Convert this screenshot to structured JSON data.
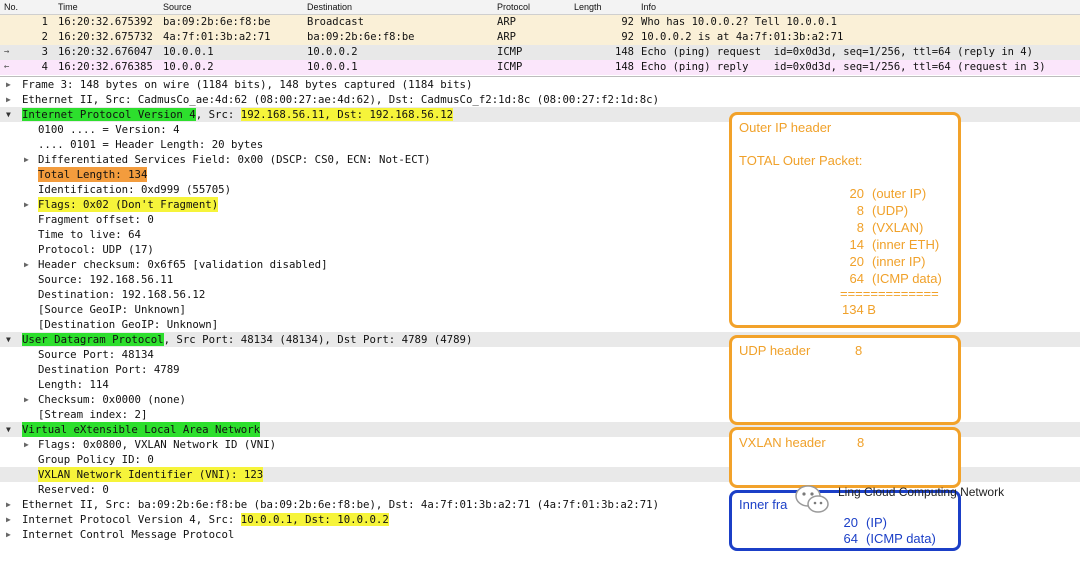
{
  "packet_list": {
    "headers": {
      "no": "No.",
      "time": "Time",
      "source": "Source",
      "destination": "Destination",
      "protocol": "Protocol",
      "length": "Length",
      "info": "Info"
    },
    "rows": [
      {
        "no": "1",
        "time": "16:20:32.675392",
        "source": "ba:09:2b:6e:f8:be",
        "destination": "Broadcast",
        "protocol": "ARP",
        "length": "92",
        "info": "Who has 10.0.0.2? Tell 10.0.0.1"
      },
      {
        "no": "2",
        "time": "16:20:32.675732",
        "source": "4a:7f:01:3b:a2:71",
        "destination": "ba:09:2b:6e:f8:be",
        "protocol": "ARP",
        "length": "92",
        "info": "10.0.0.2 is at 4a:7f:01:3b:a2:71"
      },
      {
        "no": "3",
        "time": "16:20:32.676047",
        "source": "10.0.0.1",
        "destination": "10.0.0.2",
        "protocol": "ICMP",
        "length": "148",
        "info": "Echo (ping) request  id=0x0d3d, seq=1/256, ttl=64 (reply in 4)"
      },
      {
        "no": "4",
        "time": "16:20:32.676385",
        "source": "10.0.0.2",
        "destination": "10.0.0.1",
        "protocol": "ICMP",
        "length": "148",
        "info": "Echo (ping) reply    id=0x0d3d, seq=1/256, ttl=64 (request in 3)"
      }
    ]
  },
  "details": {
    "frame": "Frame 3: 148 bytes on wire (1184 bits), 148 bytes captured (1184 bits)",
    "ethernet": "Ethernet II, Src: CadmusCo_ae:4d:62 (08:00:27:ae:4d:62), Dst: CadmusCo_f2:1d:8c (08:00:27:f2:1d:8c)",
    "ip_title": "Internet Protocol Version 4",
    "ip_sep": ", Src: ",
    "ip_src_dst": "192.168.56.11, Dst: 192.168.56.12",
    "ip_version": "0100 .... = Version: 4",
    "ip_hlen": ".... 0101 = Header Length: 20 bytes",
    "ip_dsf": "Differentiated Services Field: 0x00 (DSCP: CS0, ECN: Not-ECT)",
    "ip_total_len": "Total Length: 134",
    "ip_id": "Identification: 0xd999 (55705)",
    "ip_flags": "Flags: 0x02 (Don't Fragment)",
    "ip_frag": "Fragment offset: 0",
    "ip_ttl": "Time to live: 64",
    "ip_proto": "Protocol: UDP (17)",
    "ip_cksum": "Header checksum: 0x6f65 [validation disabled]",
    "ip_src": "Source: 192.168.56.11",
    "ip_dst": "Destination: 192.168.56.12",
    "ip_src_geo": "[Source GeoIP: Unknown]",
    "ip_dst_geo": "[Destination GeoIP: Unknown]",
    "udp_title": "User Datagram Protocol",
    "udp_rest": ", Src Port: 48134 (48134), Dst Port: 4789 (4789)",
    "udp_sport": "Source Port: 48134",
    "udp_dport": "Destination Port: 4789",
    "udp_len": "Length: 114",
    "udp_cksum": "Checksum: 0x0000 (none)",
    "udp_stream": "[Stream index: 2]",
    "vxlan_title": "Virtual eXtensible Local Area Network",
    "vxlan_flags": "Flags: 0x0800, VXLAN Network ID (VNI)",
    "vxlan_gp": "Group Policy ID: 0",
    "vxlan_vni": "VXLAN Network Identifier (VNI): 123",
    "vxlan_res": "Reserved: 0",
    "inner_eth": "Ethernet II, Src: ba:09:2b:6e:f8:be (ba:09:2b:6e:f8:be), Dst: 4a:7f:01:3b:a2:71 (4a:7f:01:3b:a2:71)",
    "inner_ip_prefix": "Internet Protocol Version 4, Src: ",
    "inner_ip_hl": "10.0.0.1, Dst: 10.0.0.2",
    "icmp": "Internet Control Message Protocol"
  },
  "annotations": {
    "outer": {
      "title": "Outer IP header",
      "subtitle": "TOTAL Outer Packet:",
      "lines": [
        {
          "num": "20",
          "label": "(outer IP)"
        },
        {
          "num": "8",
          "label": "(UDP)"
        },
        {
          "num": "8",
          "label": "(VXLAN)"
        },
        {
          "num": "14",
          "label": "(inner ETH)"
        },
        {
          "num": "20",
          "label": "(inner IP)"
        },
        {
          "num": "64",
          "label": "(ICMP data)"
        }
      ],
      "rule": "=============",
      "total": "134 B"
    },
    "udp": {
      "title": "UDP header",
      "num": "8"
    },
    "vxlan": {
      "title": "VXLAN header",
      "num": "8"
    },
    "inner": {
      "title": "Inner fra",
      "l1num": "20",
      "l1label": "(IP)",
      "l2num": "64",
      "l2label": "(ICMP data)"
    }
  },
  "watermark": "Ling Cloud Computing Network",
  "colors": {
    "highlight_yellow": "#f6f43a",
    "highlight_green": "#2ddf2d",
    "highlight_orange": "#f39c3d",
    "annotation_orange": "#f2a22a",
    "annotation_blue": "#1b3fc7"
  }
}
